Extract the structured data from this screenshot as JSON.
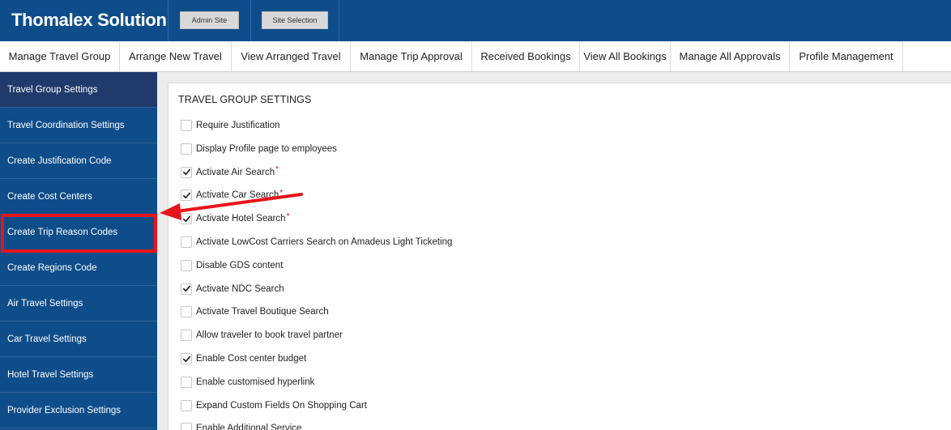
{
  "header": {
    "brand": "Thomalex Solution",
    "admin_site_label": "Admin Site",
    "site_selection_label": "Site Selection"
  },
  "nav": [
    "Manage Travel Group",
    "Arrange New Travel",
    "View Arranged Travel",
    "Manage Trip Approval",
    "Received Bookings",
    "View All Bookings",
    "Manage All Approvals",
    "Profile Management"
  ],
  "sidebar": [
    "Travel Group Settings",
    "Travel Coordination Settings",
    "Create Justification Code",
    "Create Cost Centers",
    "Create Trip Reason Codes",
    "Create Regions Code",
    "Air Travel Settings",
    "Car Travel Settings",
    "Hotel Travel Settings",
    "Provider Exclusion Settings"
  ],
  "sidebar_active_index": 0,
  "sidebar_highlight_index": 4,
  "panel": {
    "title": "TRAVEL GROUP SETTINGS",
    "options": [
      {
        "label": "Require Justification",
        "checked": false,
        "required": false
      },
      {
        "label": "Display Profile page to employees",
        "checked": false,
        "required": false
      },
      {
        "label": "Activate Air Search",
        "checked": true,
        "required": true
      },
      {
        "label": "Activate Car Search",
        "checked": true,
        "required": true
      },
      {
        "label": "Activate Hotel Search",
        "checked": true,
        "required": true
      },
      {
        "label": "Activate LowCost Carriers Search on Amadeus Light Ticketing",
        "checked": false,
        "required": false
      },
      {
        "label": "Disable GDS content",
        "checked": false,
        "required": false
      },
      {
        "label": "Activate NDC Search",
        "checked": true,
        "required": false
      },
      {
        "label": "Activate Travel Boutique Search",
        "checked": false,
        "required": false
      },
      {
        "label": "Allow traveler to book travel partner",
        "checked": false,
        "required": false
      },
      {
        "label": "Enable Cost center budget",
        "checked": true,
        "required": false
      },
      {
        "label": "Enable customised hyperlink",
        "checked": false,
        "required": false
      },
      {
        "label": "Expand Custom Fields On Shopping Cart",
        "checked": false,
        "required": false
      },
      {
        "label": "Enable Additional Service",
        "checked": false,
        "required": false
      }
    ],
    "required_marker": "*"
  },
  "colors": {
    "primary": "#0f4d8a",
    "sidebar_active": "#1f3a6b",
    "highlight": "#e8141b",
    "required": "#d0021b"
  },
  "icons": {
    "checkmark": "checkmark-icon",
    "annotation": "red-arrow-icon"
  }
}
